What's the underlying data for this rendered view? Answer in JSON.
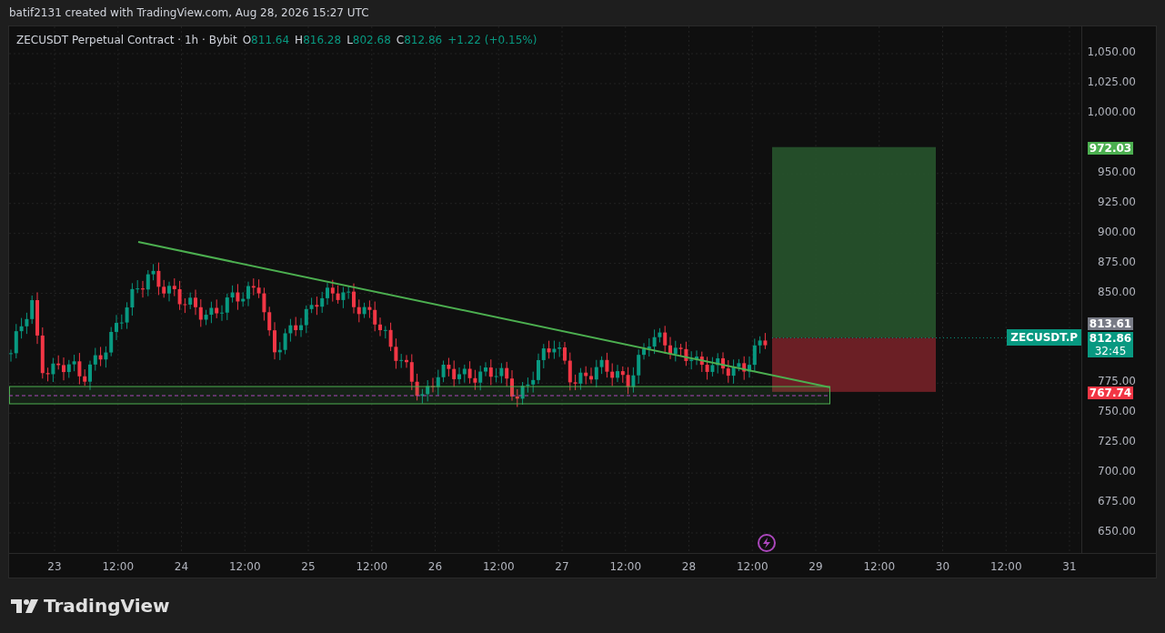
{
  "header": {
    "byline": "batif2131 created with TradingView.com, Aug 28, 2026 15:27 UTC"
  },
  "legend": {
    "symbol": "ZECUSDT Perpetual Contract · 1h · Bybit",
    "ohlc": [
      {
        "label": "O",
        "value": "811.64"
      },
      {
        "label": "H",
        "value": "816.28"
      },
      {
        "label": "L",
        "value": "802.68"
      },
      {
        "label": "C",
        "value": "812.86"
      }
    ],
    "change": "+1.22 (+0.15%)"
  },
  "price_axis": {
    "ticks": [
      "1,050.00",
      "1,025.00",
      "1,000.00",
      "950.00",
      "925.00",
      "900.00",
      "875.00",
      "850.00",
      "775.00",
      "750.00",
      "725.00",
      "700.00",
      "675.00",
      "650.00"
    ],
    "labels": [
      {
        "price": "972.03",
        "color": "#4caf50"
      },
      {
        "price": "813.61",
        "color": "#787b86"
      },
      {
        "price": "812.86",
        "countdown": "32:45",
        "color": "#089981"
      },
      {
        "price": "767.74",
        "color": "#f23645"
      }
    ]
  },
  "symbol_tag": "ZECUSDT.P",
  "time_axis": [
    "23",
    "12:00",
    "24",
    "12:00",
    "25",
    "12:00",
    "26",
    "12:00",
    "27",
    "12:00",
    "28",
    "12:00",
    "29",
    "12:00",
    "30",
    "12:00",
    "31"
  ],
  "footer": {
    "brand": "TradingView"
  }
}
